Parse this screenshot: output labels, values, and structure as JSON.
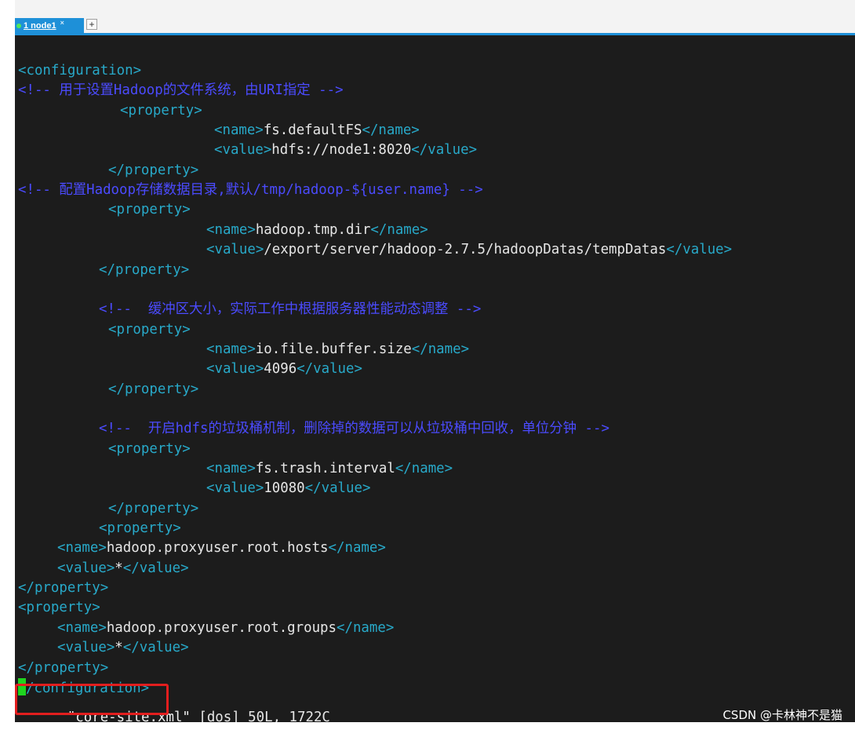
{
  "tabs": {
    "active_label": "1 node1",
    "close_glyph": "×",
    "add_glyph": "+"
  },
  "colors": {
    "tag": "#28a9c9",
    "comment": "#4b4bff",
    "text": "#e6e6e6",
    "background": "#1c1c1c",
    "cursor": "#1fd41f",
    "highlight_box": "#e21e1e",
    "tab_accent": "#1e90d8"
  },
  "lines": [
    {
      "indent": 0,
      "parts": [
        {
          "c": "tag",
          "t": "<configuration>"
        }
      ]
    },
    {
      "indent": 0,
      "parts": [
        {
          "c": "cm",
          "t": "<!-- 用于设置Hadoop的文件系统，由URI指定 -->"
        }
      ]
    },
    {
      "indent": 130,
      "parts": [
        {
          "c": "tag",
          "t": "<property>"
        }
      ]
    },
    {
      "indent": 250,
      "parts": [
        {
          "c": "tag",
          "t": "<name>"
        },
        {
          "c": "txt",
          "t": "fs.defaultFS"
        },
        {
          "c": "tag",
          "t": "</name>"
        }
      ]
    },
    {
      "indent": 250,
      "parts": [
        {
          "c": "tag",
          "t": "<value>"
        },
        {
          "c": "txt",
          "t": "hdfs://node1:8020"
        },
        {
          "c": "tag",
          "t": "</value>"
        }
      ]
    },
    {
      "indent": 115,
      "parts": [
        {
          "c": "tag",
          "t": "</property>"
        }
      ]
    },
    {
      "indent": 0,
      "parts": [
        {
          "c": "cm",
          "t": "<!-- 配置Hadoop存储数据目录,默认/tmp/hadoop-${user.name} -->"
        }
      ]
    },
    {
      "indent": 115,
      "parts": [
        {
          "c": "tag",
          "t": "<property>"
        }
      ]
    },
    {
      "indent": 240,
      "parts": [
        {
          "c": "tag",
          "t": "<name>"
        },
        {
          "c": "txt",
          "t": "hadoop.tmp.dir"
        },
        {
          "c": "tag",
          "t": "</name>"
        }
      ]
    },
    {
      "indent": 240,
      "parts": [
        {
          "c": "tag",
          "t": "<value>"
        },
        {
          "c": "txt",
          "t": "/export/server/hadoop-2.7.5/hadoopDatas/tempDatas"
        },
        {
          "c": "tag",
          "t": "</value>"
        }
      ]
    },
    {
      "indent": 103,
      "parts": [
        {
          "c": "tag",
          "t": "</property>"
        }
      ]
    },
    {
      "indent": 0,
      "parts": []
    },
    {
      "indent": 103,
      "parts": [
        {
          "c": "cm",
          "t": "<!--  缓冲区大小，实际工作中根据服务器性能动态调整 -->"
        }
      ]
    },
    {
      "indent": 115,
      "parts": [
        {
          "c": "tag",
          "t": "<property>"
        }
      ]
    },
    {
      "indent": 240,
      "parts": [
        {
          "c": "tag",
          "t": "<name>"
        },
        {
          "c": "txt",
          "t": "io.file.buffer.size"
        },
        {
          "c": "tag",
          "t": "</name>"
        }
      ]
    },
    {
      "indent": 240,
      "parts": [
        {
          "c": "tag",
          "t": "<value>"
        },
        {
          "c": "txt",
          "t": "4096"
        },
        {
          "c": "tag",
          "t": "</value>"
        }
      ]
    },
    {
      "indent": 115,
      "parts": [
        {
          "c": "tag",
          "t": "</property>"
        }
      ]
    },
    {
      "indent": 0,
      "parts": []
    },
    {
      "indent": 103,
      "parts": [
        {
          "c": "cm",
          "t": "<!--  开启hdfs的垃圾桶机制，删除掉的数据可以从垃圾桶中回收，单位分钟 -->"
        }
      ]
    },
    {
      "indent": 115,
      "parts": [
        {
          "c": "tag",
          "t": "<property>"
        }
      ]
    },
    {
      "indent": 240,
      "parts": [
        {
          "c": "tag",
          "t": "<name>"
        },
        {
          "c": "txt",
          "t": "fs.trash.interval"
        },
        {
          "c": "tag",
          "t": "</name>"
        }
      ]
    },
    {
      "indent": 240,
      "parts": [
        {
          "c": "tag",
          "t": "<value>"
        },
        {
          "c": "txt",
          "t": "10080"
        },
        {
          "c": "tag",
          "t": "</value>"
        }
      ]
    },
    {
      "indent": 115,
      "parts": [
        {
          "c": "tag",
          "t": "</property>"
        }
      ]
    },
    {
      "indent": 103,
      "parts": [
        {
          "c": "tag",
          "t": "<property>"
        }
      ]
    },
    {
      "indent": 50,
      "parts": [
        {
          "c": "tag",
          "t": "<name>"
        },
        {
          "c": "txt",
          "t": "hadoop.proxyuser.root.hosts"
        },
        {
          "c": "tag",
          "t": "</name>"
        }
      ]
    },
    {
      "indent": 50,
      "parts": [
        {
          "c": "tag",
          "t": "<value>"
        },
        {
          "c": "txt",
          "t": "*"
        },
        {
          "c": "tag",
          "t": "</value>"
        }
      ]
    },
    {
      "indent": 0,
      "parts": [
        {
          "c": "tag",
          "t": "</property>"
        }
      ]
    },
    {
      "indent": 0,
      "parts": [
        {
          "c": "tag",
          "t": "<property>"
        }
      ]
    },
    {
      "indent": 50,
      "parts": [
        {
          "c": "tag",
          "t": "<name>"
        },
        {
          "c": "txt",
          "t": "hadoop.proxyuser.root.groups"
        },
        {
          "c": "tag",
          "t": "</name>"
        }
      ]
    },
    {
      "indent": 50,
      "parts": [
        {
          "c": "tag",
          "t": "<value>"
        },
        {
          "c": "txt",
          "t": "*"
        },
        {
          "c": "tag",
          "t": "</value>"
        }
      ]
    },
    {
      "indent": 0,
      "parts": [
        {
          "c": "tag",
          "t": "</property>"
        }
      ]
    },
    {
      "indent": 0,
      "cursor": true,
      "parts": [
        {
          "c": "tag",
          "t": "/configuration>"
        }
      ]
    }
  ],
  "status": {
    "filename": "\"core-site.xml\"",
    "info": " [dos] 50L, 1722C"
  },
  "watermark": "CSDN @卡林神不是猫"
}
